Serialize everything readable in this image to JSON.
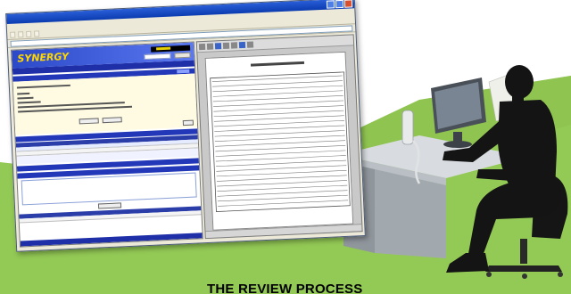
{
  "colors": {
    "green_ground": "#93c955",
    "desk_top": "#d8dce0",
    "desk_side": "#8f969c",
    "silhouette": "#141414",
    "titlebar": "#0b3bb0",
    "brand_blue": "#2c49c8",
    "logo_yellow": "#ffd700"
  },
  "app": {
    "logo": "SYNERGY"
  },
  "caption": {
    "heading": "THE REVIEW PROCESS"
  },
  "icons": [
    "minimize-icon",
    "maximize-icon",
    "close-icon",
    "browser-window",
    "person-silhouette",
    "office-desk",
    "computer-monitor",
    "desk-phone",
    "office-chair"
  ]
}
